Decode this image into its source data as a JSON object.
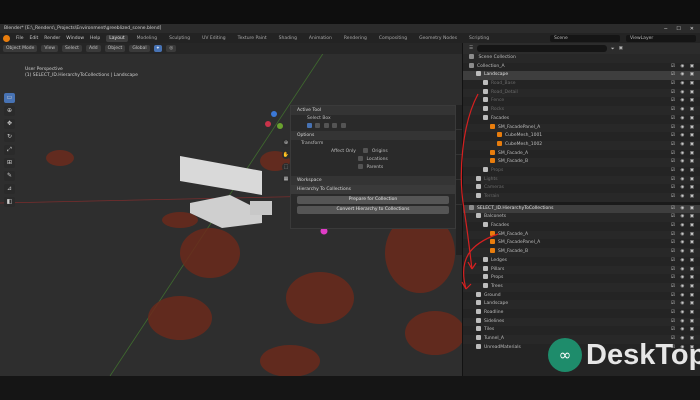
{
  "title": "Blender* [E:\\_Renders\\_Projects\\Environment\\greeblized_scene.blend]",
  "menus": [
    "File",
    "Edit",
    "Render",
    "Window",
    "Help"
  ],
  "workspaces": [
    "Layout",
    "Modeling",
    "Sculpting",
    "UV Editing",
    "Texture Paint",
    "Shading",
    "Animation",
    "Rendering",
    "Compositing",
    "Geometry Nodes",
    "Scripting"
  ],
  "active_workspace": "Layout",
  "scene": "Scene",
  "view_layer": "ViewLayer",
  "viewport": {
    "mode": "Object Mode",
    "menus": [
      "View",
      "Select",
      "Add",
      "Object"
    ],
    "transform": "Global",
    "info_line1": "User Perspective",
    "info_line2": "(1) SELECT_ID.HierarchyToCollections | Landscape"
  },
  "npanel": {
    "tool_header": "Active Tool",
    "tool_name": "Select Box",
    "options_header": "Options",
    "transform_header": "Transform",
    "affect_only": "Affect Only",
    "opt_origins": "Origins",
    "opt_locations": "Locations",
    "opt_parents": "Parents",
    "workspace_header": "Workspace",
    "h2c_header": "Hierarchy To Collections",
    "btn_prepare": "Prepare for Collection",
    "btn_convert": "Convert Hierarchy to Collections"
  },
  "outliner": {
    "title": "Scene Collection",
    "top_rows": [
      {
        "label": "Collection_A",
        "indent": 0,
        "dim": false,
        "hl": false
      },
      {
        "label": "Landscape",
        "indent": 1,
        "dim": false,
        "hl": true
      },
      {
        "label": "Road_Base",
        "indent": 2,
        "dim": true,
        "hl": false
      },
      {
        "label": "Road_Detail",
        "indent": 2,
        "dim": true,
        "hl": false
      },
      {
        "label": "Fence",
        "indent": 2,
        "dim": true,
        "hl": false
      },
      {
        "label": "Rocks",
        "indent": 2,
        "dim": true,
        "hl": false
      },
      {
        "label": "Facades",
        "indent": 2,
        "dim": false,
        "hl": false
      },
      {
        "label": "SM_FacadePanel_A",
        "indent": 3,
        "dim": false,
        "hl": false
      },
      {
        "label": "CubeMesh_1001",
        "indent": 4,
        "dim": false,
        "hl": false
      },
      {
        "label": "CubeMesh_1002",
        "indent": 4,
        "dim": false,
        "hl": false
      },
      {
        "label": "SM_Facade_A",
        "indent": 3,
        "dim": false,
        "hl": false
      },
      {
        "label": "SM_Facade_B",
        "indent": 3,
        "dim": false,
        "hl": false
      },
      {
        "label": "Props",
        "indent": 2,
        "dim": true,
        "hl": false
      },
      {
        "label": "Lights",
        "indent": 1,
        "dim": true,
        "hl": false
      },
      {
        "label": "Cameras",
        "indent": 1,
        "dim": true,
        "hl": false
      },
      {
        "label": "Terrain",
        "indent": 1,
        "dim": true,
        "hl": false
      }
    ],
    "bottom_rows": [
      {
        "label": "SELECT_ID.HierarchyToCollections",
        "indent": 0,
        "dim": false,
        "hl": true
      },
      {
        "label": "Balconets",
        "indent": 1,
        "dim": false,
        "hl": false
      },
      {
        "label": "Facades",
        "indent": 2,
        "dim": false,
        "hl": false
      },
      {
        "label": "SM_Facade_A",
        "indent": 3,
        "dim": false,
        "hl": false
      },
      {
        "label": "SM_FacadePanel_A",
        "indent": 3,
        "dim": false,
        "hl": false
      },
      {
        "label": "SM_Facade_B",
        "indent": 3,
        "dim": false,
        "hl": false
      },
      {
        "label": "Ledges",
        "indent": 2,
        "dim": false,
        "hl": false
      },
      {
        "label": "Pillars",
        "indent": 2,
        "dim": false,
        "hl": false
      },
      {
        "label": "Props",
        "indent": 2,
        "dim": false,
        "hl": false
      },
      {
        "label": "Trees",
        "indent": 2,
        "dim": false,
        "hl": false
      },
      {
        "label": "Ground",
        "indent": 1,
        "dim": false,
        "hl": false
      },
      {
        "label": "Landscape",
        "indent": 1,
        "dim": false,
        "hl": false
      },
      {
        "label": "Roadline",
        "indent": 1,
        "dim": false,
        "hl": false
      },
      {
        "label": "Sidelines",
        "indent": 1,
        "dim": false,
        "hl": false
      },
      {
        "label": "Tiles",
        "indent": 1,
        "dim": false,
        "hl": false
      },
      {
        "label": "Tunnel_A",
        "indent": 1,
        "dim": false,
        "hl": false
      },
      {
        "label": "UnreadMaterials",
        "indent": 1,
        "dim": false,
        "hl": false
      }
    ]
  },
  "watermark": "DeskTop",
  "colors": {
    "accent": "#4772b3",
    "orange": "#e87d0d",
    "annotation": "#d62020"
  }
}
